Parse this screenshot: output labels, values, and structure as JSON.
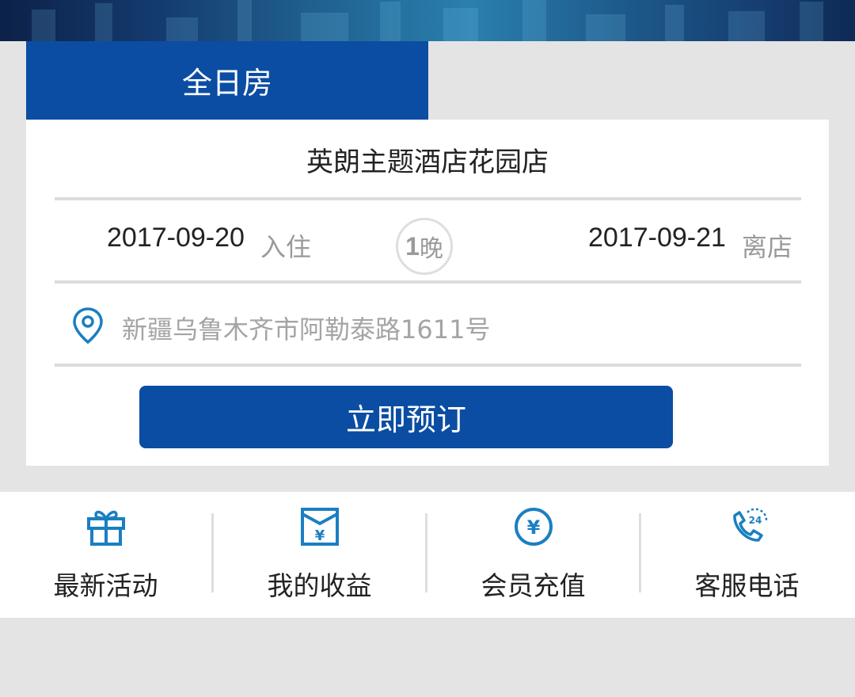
{
  "tab": {
    "label": "全日房"
  },
  "hotel": {
    "name": "英朗主题酒店花园店"
  },
  "stay": {
    "checkin_date": "2017-09-20",
    "checkin_label": "入住",
    "nights_num": "1",
    "nights_unit": "晚",
    "checkout_date": "2017-09-21",
    "checkout_label": "离店"
  },
  "address": {
    "text": "新疆乌鲁木齐市阿勒泰路1611号",
    "icon": "location-pin-icon"
  },
  "book_button": {
    "label": "立即预订"
  },
  "bottom_nav": [
    {
      "label": "最新活动",
      "icon": "gift-icon"
    },
    {
      "label": "我的收益",
      "icon": "envelope-yuan-icon"
    },
    {
      "label": "会员充值",
      "icon": "yuan-coin-icon"
    },
    {
      "label": "客服电话",
      "icon": "phone-24-icon"
    }
  ],
  "colors": {
    "primary": "#0b4da2",
    "icon_blue": "#1a7fc1",
    "muted_text": "#9a9a9a",
    "divider": "#dcdcdc",
    "background": "#e4e4e4"
  }
}
